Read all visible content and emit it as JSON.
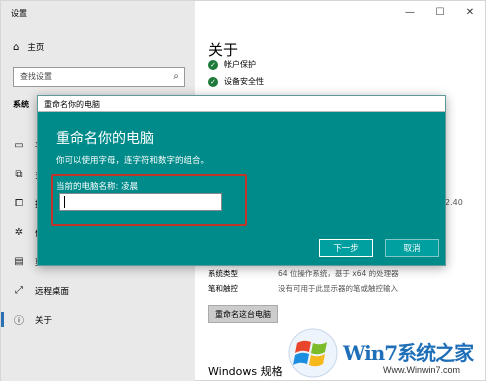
{
  "window": {
    "title": "设置",
    "controls": {
      "minimize": "—",
      "maximize": "☐",
      "close": "✕"
    }
  },
  "sidebar": {
    "home_label": "主页",
    "search_placeholder": "查找设置",
    "section_label": "系统",
    "items": [
      {
        "label": "平",
        "icon": "display-icon"
      },
      {
        "label": "多",
        "icon": "multitasking-icon"
      },
      {
        "label": "投",
        "icon": "projecting-icon"
      },
      {
        "label": "体",
        "icon": "shared-experiences-icon"
      },
      {
        "label": "剪",
        "icon": "clipboard-icon"
      },
      {
        "label": "远程桌面",
        "icon": "remote-desktop-icon"
      },
      {
        "label": "关于",
        "icon": "info-icon"
      }
    ]
  },
  "main": {
    "title": "关于",
    "status": [
      "帐户保护",
      "设备安全性"
    ],
    "specs": [
      {
        "key": "系统类型",
        "value": "64 位操作系统，基于 x64 的处理器"
      },
      {
        "key": "笔和触控",
        "value": "没有可用于此显示器的笔或触控输入"
      }
    ],
    "rename_button": "重命名这台电脑",
    "windows_spec": "Windows 规格",
    "partial_value": "2.40"
  },
  "dialog": {
    "title": "重命名你的电脑",
    "heading": "重命名你的电脑",
    "description": "你可以使用字母，连字符和数字的组合。",
    "current_name_label": "当前的电脑名称: 凌晨",
    "input_value": "",
    "next_button": "下一步",
    "cancel_button": "取消"
  },
  "watermark": {
    "text": "Win7系统之家",
    "url": "Www.Winwin7.com"
  }
}
